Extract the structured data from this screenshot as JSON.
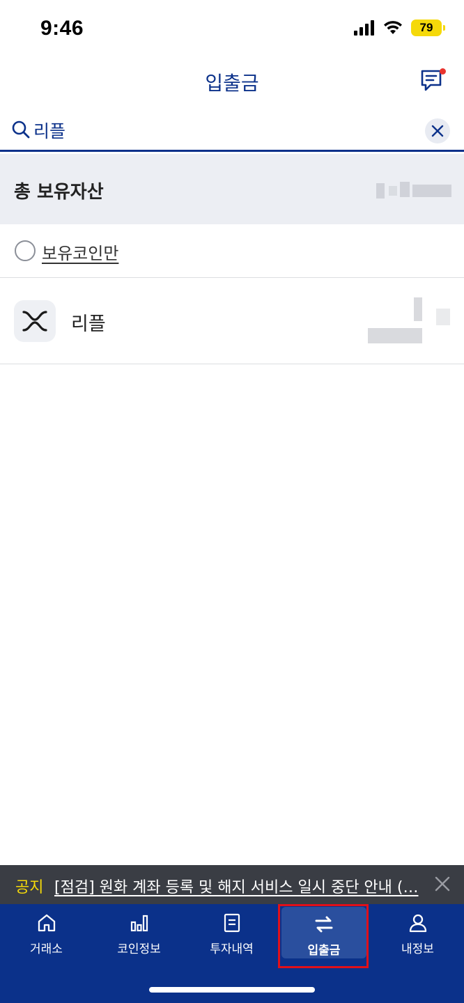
{
  "status_bar": {
    "time": "9:46",
    "battery": "79"
  },
  "header": {
    "title": "입출금"
  },
  "search": {
    "value": "리플",
    "placeholder": ""
  },
  "total_assets": {
    "label": "총 보유자산"
  },
  "filter": {
    "label": "보유코인만"
  },
  "coins": [
    {
      "name": "리플"
    }
  ],
  "notice": {
    "tag": "공지",
    "text": "[점검] 원화 계좌 등록 및 해지 서비스 일시 중단 안내 (…"
  },
  "nav": {
    "items": [
      {
        "label": "거래소",
        "icon": "home-icon"
      },
      {
        "label": "코인정보",
        "icon": "bar-chart-icon"
      },
      {
        "label": "투자내역",
        "icon": "document-icon"
      },
      {
        "label": "입출금",
        "icon": "transfer-arrows-icon",
        "active": true
      },
      {
        "label": "내정보",
        "icon": "user-icon"
      }
    ]
  },
  "colors": {
    "brand": "#0b318a",
    "notice_tag": "#f5d90a",
    "badge": "#e8342f",
    "highlight": "#e0101a"
  }
}
